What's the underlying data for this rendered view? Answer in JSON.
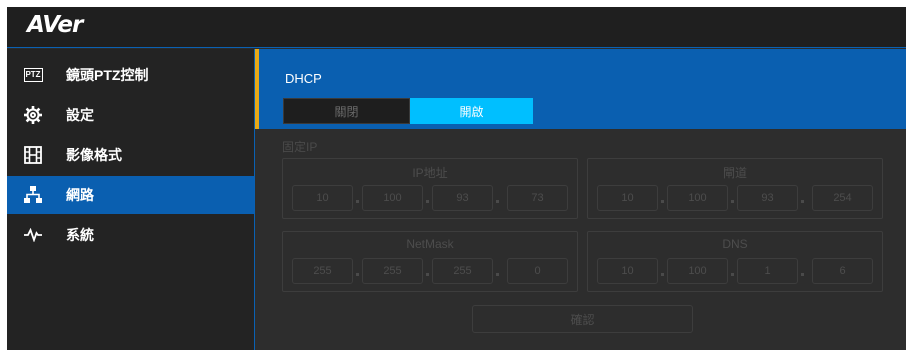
{
  "brand": {
    "logo_text": "AVer"
  },
  "sidebar": {
    "items": [
      {
        "label": "鏡頭PTZ控制",
        "icon": "ptz-icon",
        "icon_text": "PTZ",
        "active": false
      },
      {
        "label": "設定",
        "icon": "gear-icon",
        "active": false
      },
      {
        "label": "影像格式",
        "icon": "film-icon",
        "active": false
      },
      {
        "label": "網路",
        "icon": "network-icon",
        "active": true
      },
      {
        "label": "系統",
        "icon": "pulse-icon",
        "active": false
      }
    ]
  },
  "network": {
    "dhcp": {
      "title": "DHCP",
      "off_label": "關閉",
      "on_label": "開啟",
      "selected": "on"
    },
    "static_label": "固定IP",
    "ip": {
      "title": "IP地址",
      "octets": [
        "10",
        "100",
        "93",
        "73"
      ]
    },
    "gateway": {
      "title": "閘道",
      "octets": [
        "10",
        "100",
        "93",
        "254"
      ]
    },
    "netmask": {
      "title": "NetMask",
      "octets": [
        "255",
        "255",
        "255",
        "0"
      ]
    },
    "dns": {
      "title": "DNS",
      "octets": [
        "10",
        "100",
        "1",
        "6"
      ]
    },
    "confirm_label": "確認"
  },
  "colors": {
    "accent": "#0a5fb0",
    "toggle_on": "#00bfff",
    "indicator": "#e6a817"
  }
}
